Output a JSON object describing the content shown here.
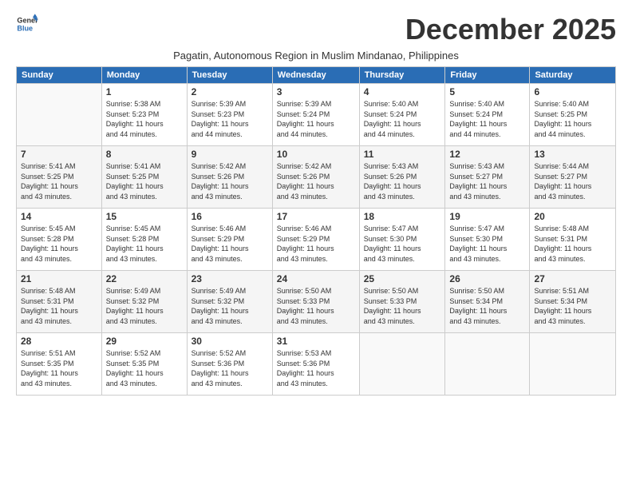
{
  "logo": {
    "general": "General",
    "blue": "Blue"
  },
  "title": "December 2025",
  "subtitle": "Pagatin, Autonomous Region in Muslim Mindanao, Philippines",
  "weekdays": [
    "Sunday",
    "Monday",
    "Tuesday",
    "Wednesday",
    "Thursday",
    "Friday",
    "Saturday"
  ],
  "weeks": [
    [
      {
        "day": "",
        "info": ""
      },
      {
        "day": "1",
        "info": "Sunrise: 5:38 AM\nSunset: 5:23 PM\nDaylight: 11 hours\nand 44 minutes."
      },
      {
        "day": "2",
        "info": "Sunrise: 5:39 AM\nSunset: 5:23 PM\nDaylight: 11 hours\nand 44 minutes."
      },
      {
        "day": "3",
        "info": "Sunrise: 5:39 AM\nSunset: 5:24 PM\nDaylight: 11 hours\nand 44 minutes."
      },
      {
        "day": "4",
        "info": "Sunrise: 5:40 AM\nSunset: 5:24 PM\nDaylight: 11 hours\nand 44 minutes."
      },
      {
        "day": "5",
        "info": "Sunrise: 5:40 AM\nSunset: 5:24 PM\nDaylight: 11 hours\nand 44 minutes."
      },
      {
        "day": "6",
        "info": "Sunrise: 5:40 AM\nSunset: 5:25 PM\nDaylight: 11 hours\nand 44 minutes."
      }
    ],
    [
      {
        "day": "7",
        "info": "Sunrise: 5:41 AM\nSunset: 5:25 PM\nDaylight: 11 hours\nand 43 minutes."
      },
      {
        "day": "8",
        "info": "Sunrise: 5:41 AM\nSunset: 5:25 PM\nDaylight: 11 hours\nand 43 minutes."
      },
      {
        "day": "9",
        "info": "Sunrise: 5:42 AM\nSunset: 5:26 PM\nDaylight: 11 hours\nand 43 minutes."
      },
      {
        "day": "10",
        "info": "Sunrise: 5:42 AM\nSunset: 5:26 PM\nDaylight: 11 hours\nand 43 minutes."
      },
      {
        "day": "11",
        "info": "Sunrise: 5:43 AM\nSunset: 5:26 PM\nDaylight: 11 hours\nand 43 minutes."
      },
      {
        "day": "12",
        "info": "Sunrise: 5:43 AM\nSunset: 5:27 PM\nDaylight: 11 hours\nand 43 minutes."
      },
      {
        "day": "13",
        "info": "Sunrise: 5:44 AM\nSunset: 5:27 PM\nDaylight: 11 hours\nand 43 minutes."
      }
    ],
    [
      {
        "day": "14",
        "info": "Sunrise: 5:45 AM\nSunset: 5:28 PM\nDaylight: 11 hours\nand 43 minutes."
      },
      {
        "day": "15",
        "info": "Sunrise: 5:45 AM\nSunset: 5:28 PM\nDaylight: 11 hours\nand 43 minutes."
      },
      {
        "day": "16",
        "info": "Sunrise: 5:46 AM\nSunset: 5:29 PM\nDaylight: 11 hours\nand 43 minutes."
      },
      {
        "day": "17",
        "info": "Sunrise: 5:46 AM\nSunset: 5:29 PM\nDaylight: 11 hours\nand 43 minutes."
      },
      {
        "day": "18",
        "info": "Sunrise: 5:47 AM\nSunset: 5:30 PM\nDaylight: 11 hours\nand 43 minutes."
      },
      {
        "day": "19",
        "info": "Sunrise: 5:47 AM\nSunset: 5:30 PM\nDaylight: 11 hours\nand 43 minutes."
      },
      {
        "day": "20",
        "info": "Sunrise: 5:48 AM\nSunset: 5:31 PM\nDaylight: 11 hours\nand 43 minutes."
      }
    ],
    [
      {
        "day": "21",
        "info": "Sunrise: 5:48 AM\nSunset: 5:31 PM\nDaylight: 11 hours\nand 43 minutes."
      },
      {
        "day": "22",
        "info": "Sunrise: 5:49 AM\nSunset: 5:32 PM\nDaylight: 11 hours\nand 43 minutes."
      },
      {
        "day": "23",
        "info": "Sunrise: 5:49 AM\nSunset: 5:32 PM\nDaylight: 11 hours\nand 43 minutes."
      },
      {
        "day": "24",
        "info": "Sunrise: 5:50 AM\nSunset: 5:33 PM\nDaylight: 11 hours\nand 43 minutes."
      },
      {
        "day": "25",
        "info": "Sunrise: 5:50 AM\nSunset: 5:33 PM\nDaylight: 11 hours\nand 43 minutes."
      },
      {
        "day": "26",
        "info": "Sunrise: 5:50 AM\nSunset: 5:34 PM\nDaylight: 11 hours\nand 43 minutes."
      },
      {
        "day": "27",
        "info": "Sunrise: 5:51 AM\nSunset: 5:34 PM\nDaylight: 11 hours\nand 43 minutes."
      }
    ],
    [
      {
        "day": "28",
        "info": "Sunrise: 5:51 AM\nSunset: 5:35 PM\nDaylight: 11 hours\nand 43 minutes."
      },
      {
        "day": "29",
        "info": "Sunrise: 5:52 AM\nSunset: 5:35 PM\nDaylight: 11 hours\nand 43 minutes."
      },
      {
        "day": "30",
        "info": "Sunrise: 5:52 AM\nSunset: 5:36 PM\nDaylight: 11 hours\nand 43 minutes."
      },
      {
        "day": "31",
        "info": "Sunrise: 5:53 AM\nSunset: 5:36 PM\nDaylight: 11 hours\nand 43 minutes."
      },
      {
        "day": "",
        "info": ""
      },
      {
        "day": "",
        "info": ""
      },
      {
        "day": "",
        "info": ""
      }
    ]
  ]
}
